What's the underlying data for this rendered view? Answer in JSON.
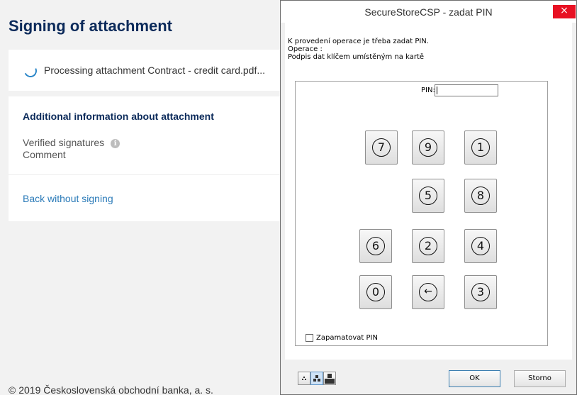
{
  "webpage": {
    "title": "Signing of attachment",
    "processing_text": "Processing attachment Contract - credit card.pdf...",
    "info_heading": "Additional information about attachment",
    "verified_signatures": "Verified signatures",
    "info_icon_glyph": "i",
    "comment": "Comment",
    "back_link": "Back without signing",
    "footer": "© 2019 Československá obchodní banka, a. s."
  },
  "dialog": {
    "title": "SecureStoreCSP - zadat PIN",
    "close_glyph": "×",
    "message_line1": "K provedení operace je třeba zadat PIN.",
    "message_line2": "Operace :",
    "message_line3": "Podpis dat klíčem umístěným na kartě",
    "pin_label": "PIN:",
    "pin_value": "",
    "keys": [
      "7",
      "9",
      "1",
      "5",
      "8",
      "6",
      "2",
      "4",
      "0",
      "←",
      "3"
    ],
    "remember_label": "Zapamatovat PIN",
    "remember_checked": false,
    "ok_label": "OK",
    "cancel_label": "Storno"
  },
  "icons": {
    "spinner": "loading-spinner-icon",
    "info": "info-icon",
    "close": "close-icon",
    "backspace": "arrow-left-icon"
  },
  "colors": {
    "brand_dark_blue": "#0b2a5a",
    "link_blue": "#2a7ab8",
    "close_red": "#e81123"
  }
}
